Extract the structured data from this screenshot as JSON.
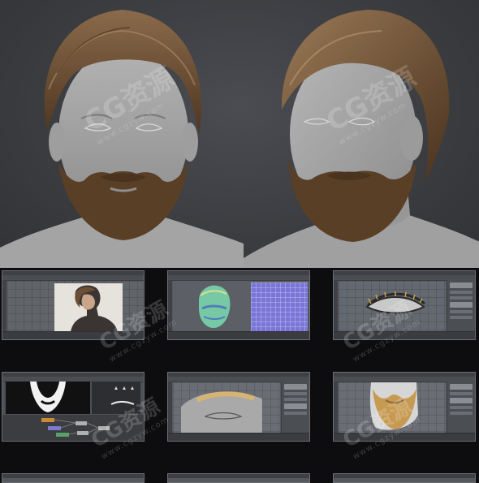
{
  "watermark": {
    "brand": "CG资源",
    "url": "www.cgzyw.com"
  },
  "hero": {
    "views": [
      "front-view",
      "three-quarter-view"
    ],
    "colors": {
      "background": "#3d3f43",
      "skin": "#a3a3a3",
      "hair": "#6b4a2c",
      "beard": "#5a3f27"
    }
  },
  "screenshots": [
    {
      "id": "photo-reference",
      "row": 1,
      "col": 1
    },
    {
      "id": "uv-layout",
      "row": 1,
      "col": 2
    },
    {
      "id": "eyelash-groom",
      "row": 1,
      "col": 3
    },
    {
      "id": "beard-mask-node-graph",
      "row": 2,
      "col": 1
    },
    {
      "id": "eyebrow-groom",
      "row": 2,
      "col": 2
    },
    {
      "id": "beard-groom",
      "row": 2,
      "col": 3
    },
    {
      "id": "row3-partial-1",
      "row": 3,
      "col": 1
    },
    {
      "id": "row3-partial-2",
      "row": 3,
      "col": 2
    },
    {
      "id": "row3-partial-3",
      "row": 3,
      "col": 3
    }
  ]
}
